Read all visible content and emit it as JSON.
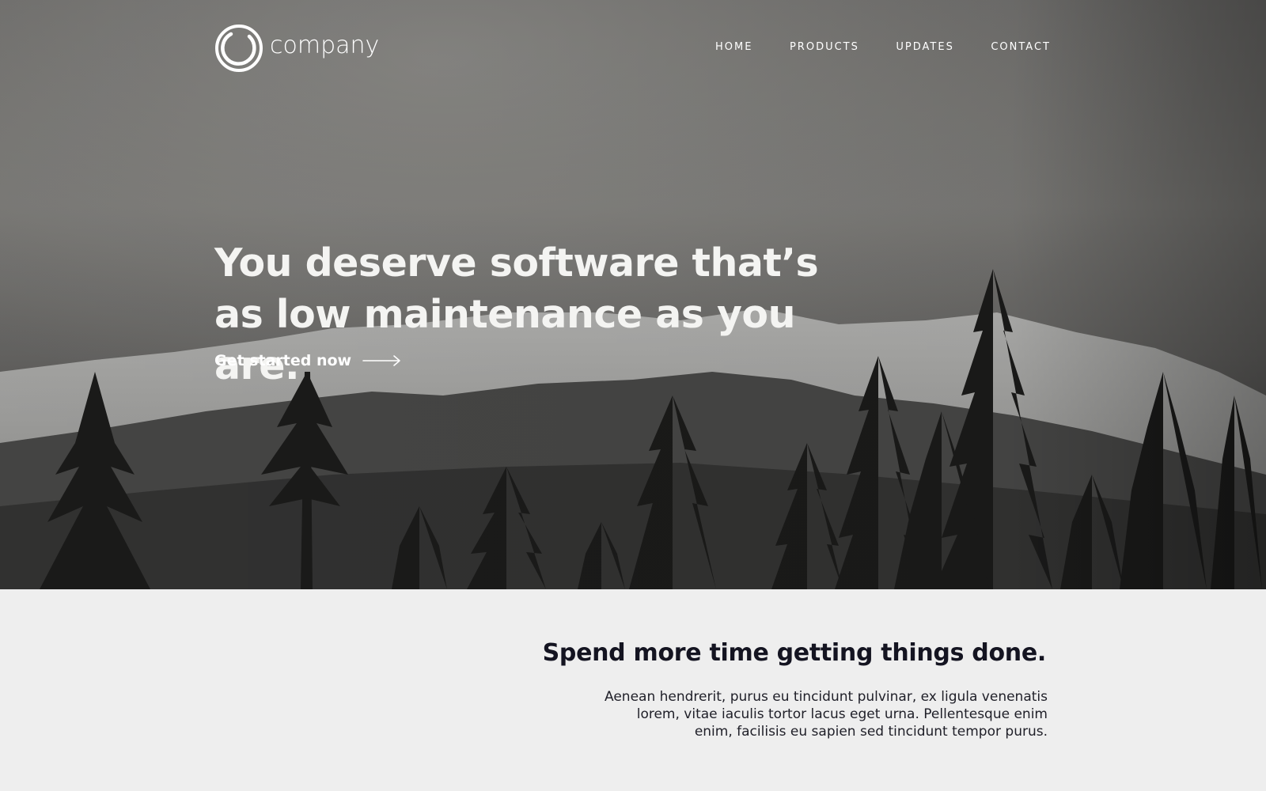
{
  "brand": {
    "name": "company"
  },
  "nav": {
    "items": [
      {
        "label": "HOME"
      },
      {
        "label": "PRODUCTS"
      },
      {
        "label": "UPDATES"
      },
      {
        "label": "CONTACT"
      }
    ]
  },
  "hero": {
    "headline": "You deserve software that’s as low maintenance as you are.",
    "cta_label": "Get started now"
  },
  "feature": {
    "title": "Spend more time getting things done.",
    "body": "Aenean hendrerit, purus eu tincidunt pulvinar, ex ligula venenatis lorem, vitae iaculis tortor lacus eget urna. Pellentesque enim enim, facilisis eu sapien sed  tincidunt tempor purus."
  },
  "colors": {
    "hero_overlay": "#3a3a3a",
    "text_light": "#ffffff",
    "section_bg": "#eeeeee",
    "text_dark": "#141421"
  }
}
